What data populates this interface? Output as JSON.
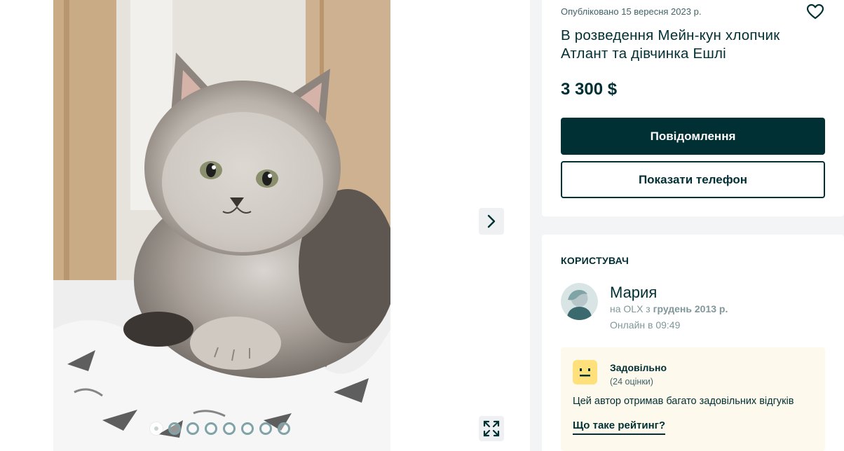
{
  "gallery": {
    "photo_alt": "Maine Coon kitten",
    "dots_total": 8,
    "active_dot": 1
  },
  "ad": {
    "posted_date": "Опубліковано 15 вересня 2023 р.",
    "title": "В розведення Мейн-кун хлопчик Атлант та дівчинка Ешлі",
    "price": "3 300 $",
    "message_button": "Повідомлення",
    "phone_button": "Показати телефон"
  },
  "user": {
    "heading": "КОРИСТУВАЧ",
    "name": "Мария",
    "since_prefix": "на OLX з ",
    "since_date": "грудень 2013 р.",
    "online": "Онлайн в 09:49"
  },
  "rating": {
    "title": "Задовільно",
    "count": "(24 оцінки)",
    "description": "Цей автор отримав багато задовільних відгуків",
    "link": "Що таке рейтинг?"
  },
  "colors": {
    "primary": "#002f34",
    "rating_bg": "#fdf9ec",
    "rating_face": "#ffe07a",
    "muted": "#7f9799"
  },
  "icons": [
    "chevron-right-icon",
    "expand-icon",
    "heart-icon",
    "avatar-placeholder-icon",
    "neutral-face-icon"
  ]
}
